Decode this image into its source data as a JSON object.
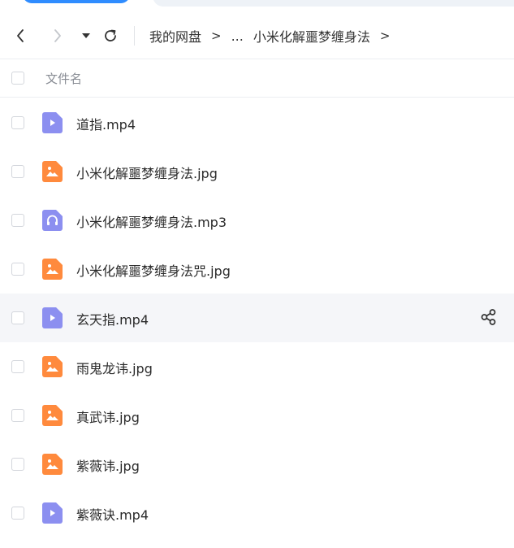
{
  "colors": {
    "accent_blue": "#2f8cff",
    "video_icon": "#8c8ff0",
    "image_icon": "#ff8a3d",
    "audio_icon": "#8c8ff0",
    "row_hover": "#f5f6f9"
  },
  "navbar": {
    "back_icon": "chevron-left-icon",
    "forward_icon": "chevron-right-icon",
    "menu_icon": "caret-down-icon",
    "refresh_icon": "refresh-icon",
    "breadcrumb": {
      "root": "我的网盘",
      "ellipsis": "...",
      "current": "小米化解噩梦缠身法",
      "separator": ">"
    }
  },
  "list": {
    "header_label": "文件名",
    "files": [
      {
        "name": "道指.mp4",
        "type": "video",
        "icon": "video-file-icon"
      },
      {
        "name": "小米化解噩梦缠身法.jpg",
        "type": "image",
        "icon": "image-file-icon"
      },
      {
        "name": "小米化解噩梦缠身法.mp3",
        "type": "audio",
        "icon": "audio-file-icon"
      },
      {
        "name": "小米化解噩梦缠身法咒.jpg",
        "type": "image",
        "icon": "image-file-icon"
      },
      {
        "name": "玄天指.mp4",
        "type": "video",
        "icon": "video-file-icon",
        "hovered": true,
        "action_icon": "share-icon"
      },
      {
        "name": "雨鬼龙讳.jpg",
        "type": "image",
        "icon": "image-file-icon"
      },
      {
        "name": "真武讳.jpg",
        "type": "image",
        "icon": "image-file-icon"
      },
      {
        "name": "紫薇讳.jpg",
        "type": "image",
        "icon": "image-file-icon"
      },
      {
        "name": "紫薇诀.mp4",
        "type": "video",
        "icon": "video-file-icon"
      }
    ]
  }
}
